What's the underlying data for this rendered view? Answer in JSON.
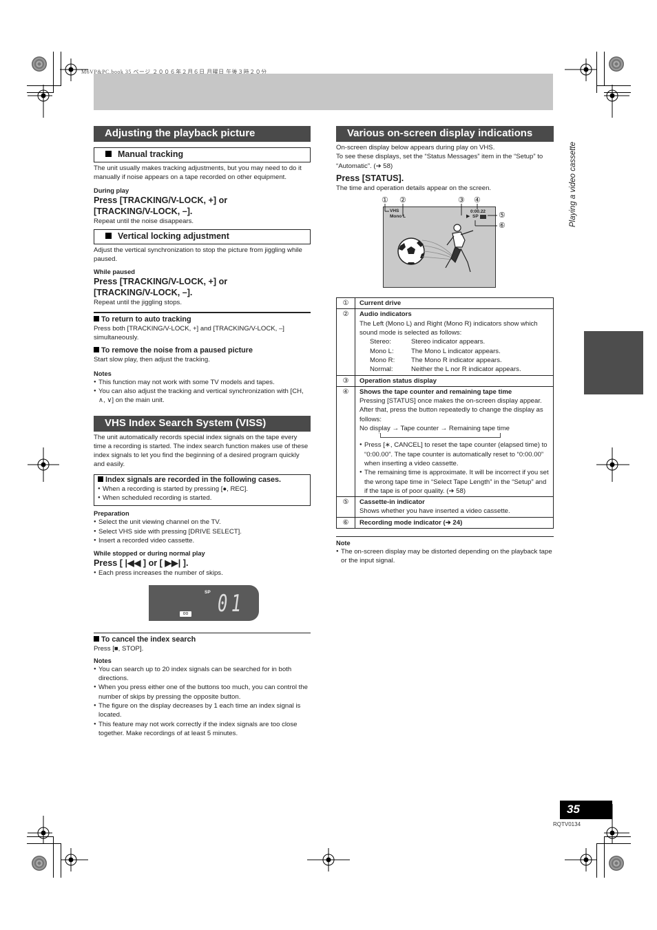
{
  "meta": {
    "print_line": "M6VP&PC.book  35 ページ  ２００６年２月６日  月曜日  午後３時２０分"
  },
  "side_label": "Playing a video cassette",
  "page_number": "35",
  "doc_id": "RQTV0134",
  "left": {
    "section1": {
      "title": "Adjusting the playback picture",
      "manual_tracking": {
        "heading": "Manual tracking",
        "body": "The unit usually makes tracking adjustments, but you may need to do it manually if noise appears on a tape recorded on other equipment.",
        "condition": "During play",
        "press_line1": "Press [TRACKING/V-LOCK, +] or",
        "press_line2": "[TRACKING/V-LOCK, –].",
        "result": "Repeat until the noise disappears."
      },
      "vertical_locking": {
        "heading": "Vertical locking adjustment",
        "body": "Adjust the vertical synchronization to stop the picture from jiggling while paused.",
        "condition": "While paused",
        "press_line1": "Press [TRACKING/V-LOCK, +] or",
        "press_line2": "[TRACKING/V-LOCK, –].",
        "result": "Repeat until the jiggling stops."
      },
      "auto_tracking": {
        "heading": "To return to auto tracking",
        "body": "Press both [TRACKING/V-LOCK, +] and [TRACKING/V-LOCK, –] simultaneously."
      },
      "remove_noise": {
        "heading": "To remove the noise from a paused picture",
        "body": "Start slow play, then adjust the tracking."
      },
      "notes": {
        "heading": "Notes",
        "items": [
          "This function may not work with some TV models and tapes.",
          "You can also adjust the tracking and vertical synchronization with [CH, ∧, ∨] on the main unit."
        ]
      }
    },
    "section2": {
      "title": "VHS Index Search System (VISS)",
      "intro": "The unit automatically records special index signals on the tape every time a recording is started. The index search function makes use of these index signals to let you find the beginning of a desired program quickly and easily.",
      "box": {
        "heading": "Index signals are recorded in the following cases.",
        "items": [
          "When a recording is started by pressing [●, REC].",
          "When scheduled recording is started."
        ]
      },
      "preparation": {
        "heading": "Preparation",
        "items": [
          "Select the unit viewing channel on the TV.",
          "Select VHS side with pressing [DRIVE SELECT].",
          "Insert a recorded video cassette."
        ]
      },
      "condition": "While stopped or during normal play",
      "press": "Press [ |◀◀ ] or [ ▶▶| ].",
      "press_note": "Each press increases the number of skips.",
      "display": {
        "mode": "SP",
        "digits": "01"
      },
      "cancel": {
        "heading": "To cancel the index search",
        "body": "Press [■, STOP]."
      },
      "notes": {
        "heading": "Notes",
        "items": [
          "You can search up to 20 index signals can be searched for in both directions.",
          "When you press either one of the buttons too much, you can control the number of skips by pressing the opposite button.",
          "The figure on the display decreases by 1 each time an index signal is located.",
          "This feature may not work correctly if the index signals are too close together. Make recordings of at least 5 minutes."
        ]
      }
    }
  },
  "right": {
    "title": "Various on-screen display indications",
    "intro1": "On-screen display below appears during play on VHS.",
    "intro2": "To see these displays, set the “Status Messages” item in the “Setup” to “Automatic”. (➔ 58)",
    "press": "Press [STATUS].",
    "press_result": "The time and operation details appear on the screen.",
    "screen": {
      "callouts": [
        "①",
        "②",
        "③",
        "④",
        "⑤",
        "⑥"
      ],
      "drive": "VHS",
      "audio": "Mono L",
      "counter": "0:00.22",
      "mode": "SP"
    },
    "table": [
      {
        "num": "①",
        "title": "Current drive"
      },
      {
        "num": "②",
        "title": "Audio indicators",
        "body": "The Left (Mono L) and Right (Mono R) indicators show which sound mode is selected as follows:",
        "modes": [
          {
            "k": "Stereo:",
            "v": "Stereo indicator appears."
          },
          {
            "k": "Mono L:",
            "v": "The Mono L indicator appears."
          },
          {
            "k": "Mono R:",
            "v": "The Mono R indicator appears."
          },
          {
            "k": "Normal:",
            "v": "Neither the L nor R indicator appears."
          }
        ]
      },
      {
        "num": "③",
        "title": "Operation status display"
      },
      {
        "num": "④",
        "title": "Shows the tape counter and remaining tape time",
        "body": "Pressing [STATUS] once makes the on-screen display appear. After that, press the button repeatedly to change the display as follows:",
        "cycle": "No display → Tape counter → Remaining tape time",
        "bullets": [
          "Press [∗, CANCEL] to reset the tape counter (elapsed time) to “0:00.00”. The tape counter is automatically reset to “0:00.00” when inserting a video cassette.",
          "The remaining time is approximate. It will be incorrect if you set the wrong tape time in “Select Tape Length” in the “Setup” and if the tape is of poor quality. (➔ 58)"
        ]
      },
      {
        "num": "⑤",
        "title": "Cassette-in indicator",
        "body": "Shows whether you have inserted a video cassette."
      },
      {
        "num": "⑥",
        "title": "Recording mode indicator (➔ 24)"
      }
    ],
    "note": {
      "heading": "Note",
      "items": [
        "The on-screen display may be distorted depending on the playback tape or the input signal."
      ]
    }
  }
}
